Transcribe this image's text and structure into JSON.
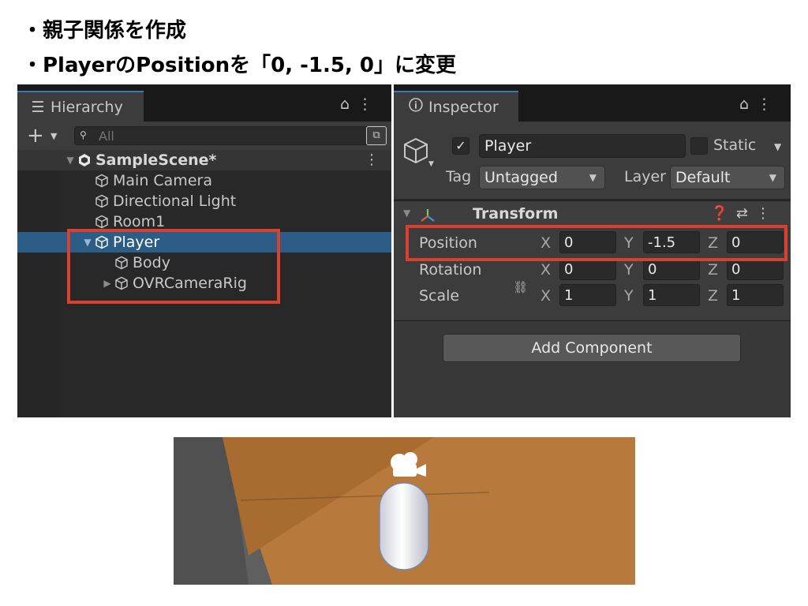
{
  "slide": {
    "bullets": [
      "・親子関係を作成",
      "・PlayerのPositionを「0, -1.5, 0」に変更"
    ]
  },
  "hierarchy": {
    "tab_label": "Hierarchy",
    "search_placeholder": "All",
    "add_label": "+",
    "scene": "SampleScene*",
    "items": [
      {
        "label": "Main Camera"
      },
      {
        "label": "Directional Light"
      },
      {
        "label": "Room1"
      },
      {
        "label": "Player",
        "selected": true,
        "expanded": true
      },
      {
        "label": "Body"
      },
      {
        "label": "OVRCameraRig",
        "collapsed": true
      }
    ]
  },
  "inspector": {
    "tab_label": "Inspector",
    "object_name": "Player",
    "active": true,
    "static_label": "Static",
    "tag_label": "Tag",
    "tag_value": "Untagged",
    "layer_label": "Layer",
    "layer_value": "Default",
    "component_title": "Transform",
    "properties": [
      {
        "label": "Position",
        "x": "0",
        "y": "-1.5",
        "z": "0"
      },
      {
        "label": "Rotation",
        "x": "0",
        "y": "0",
        "z": "0"
      },
      {
        "label": "Scale",
        "x": "1",
        "y": "1",
        "z": "1"
      }
    ],
    "axis_x": "X",
    "axis_y": "Y",
    "axis_z": "Z",
    "add_component_label": "Add Component"
  },
  "colors": {
    "selection": "#2c5d87",
    "highlight": "#d9402f",
    "floor": "#b77a3c"
  }
}
